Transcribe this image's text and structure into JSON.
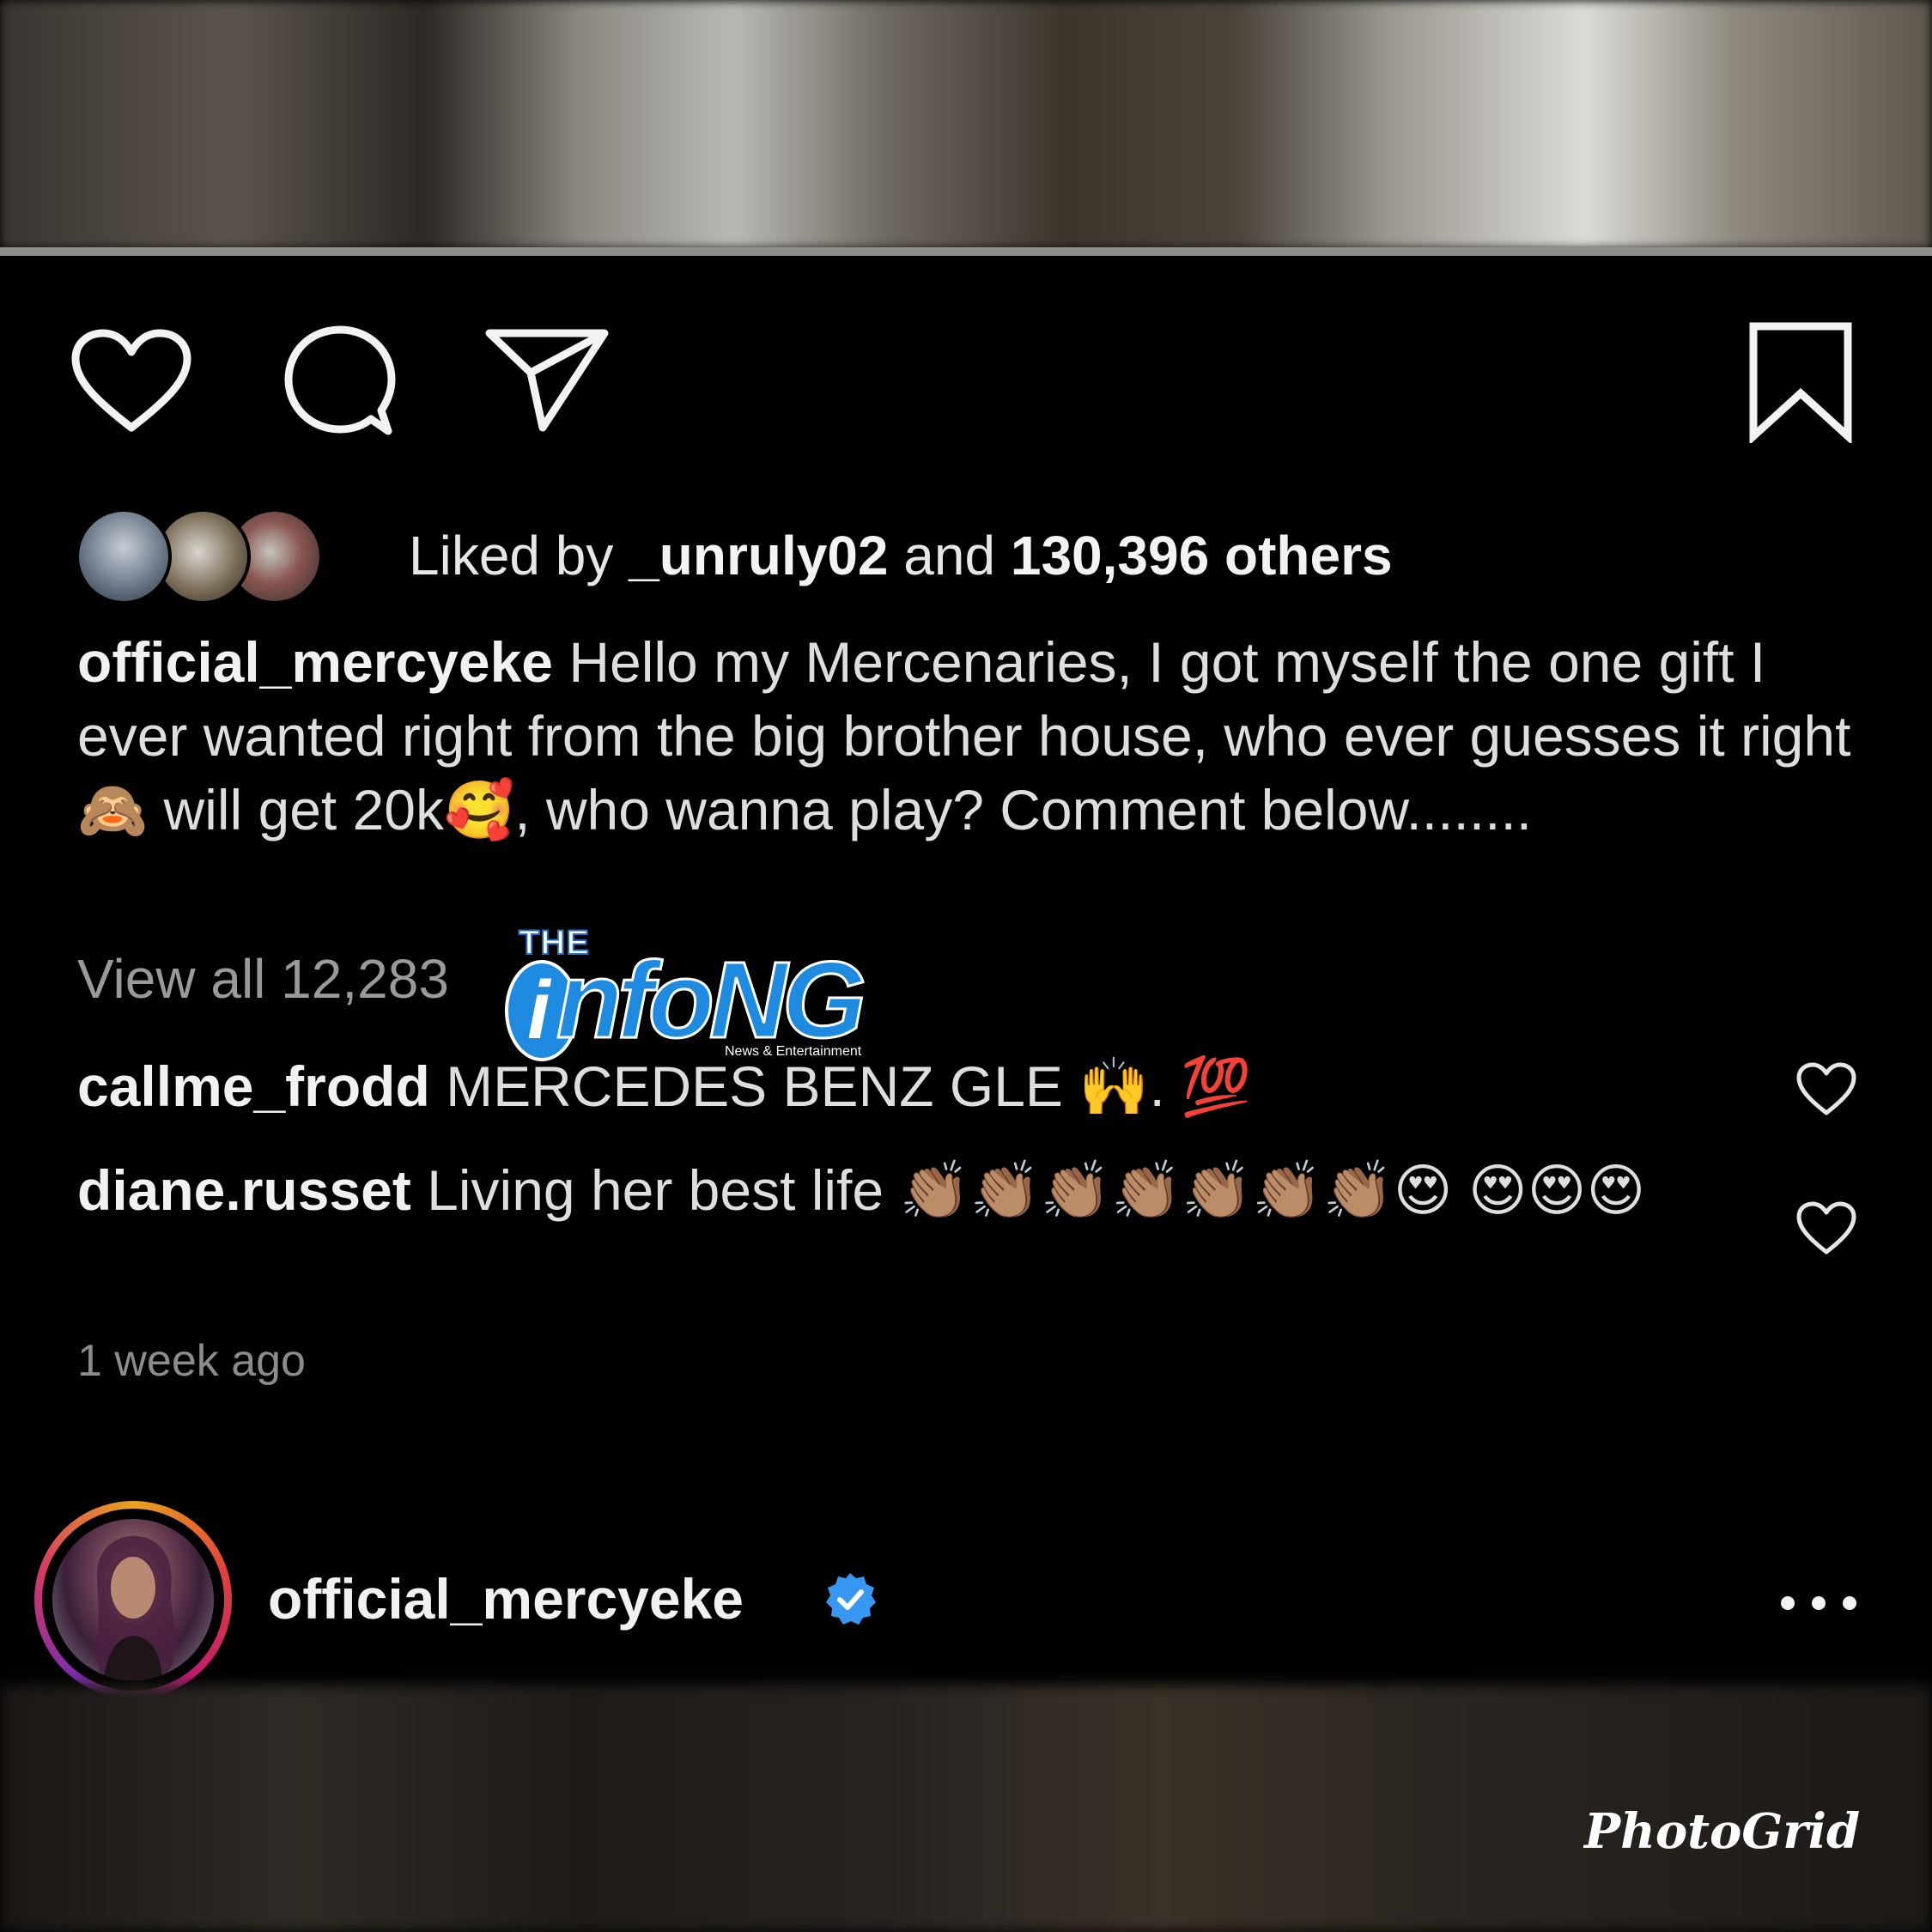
{
  "post": {
    "liked_prefix": "Liked by ",
    "liked_user": "_unruly02",
    "liked_middle": " and ",
    "liked_count": "130,396 others",
    "caption_user": "official_mercyeke",
    "caption_part1": " Hello my Mercenaries, I got myself the one gift I ever wanted right from the big brother house, who ever guesses it right ",
    "caption_emoji1": "🙈",
    "caption_part2": " will get 20k",
    "caption_emoji2": "🥰",
    "caption_part3": ", who wanna play? Comment below........",
    "view_all": "View all 12,283",
    "timestamp": "1 week ago"
  },
  "comments": [
    {
      "user": "callme_frodd",
      "text": " MERCEDES BENZ GLE ",
      "emoji": "🙌. 💯"
    },
    {
      "user": "diane.russet",
      "text": " Living her best life ",
      "emoji": "👏🏽👏🏽👏🏽👏🏽👏🏽👏🏽👏🏽😍 😍😍😍"
    }
  ],
  "profile": {
    "username": "official_mercyeke",
    "verified": true
  },
  "watermark": {
    "the": "THE",
    "i": "i",
    "brand": "nfoNG",
    "sub": "News & Entertainment"
  },
  "footer": {
    "photogrid": "PhotoGrid"
  },
  "colors": {
    "accent_blue": "#3897f0",
    "background": "#000000"
  }
}
